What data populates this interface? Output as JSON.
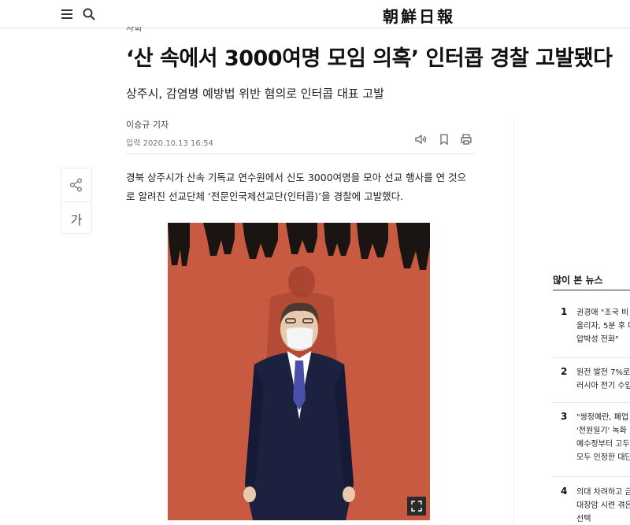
{
  "header": {
    "logo": "朝鮮日報",
    "menu_icon": "hamburger-menu-icon",
    "search_icon": "search-icon"
  },
  "article": {
    "section": "사회",
    "headline": "‘산 속에서 3000여명 모임 의혹’ 인터콥 경찰 고발됐다",
    "subheadline": "상주시, 감염병 예방법 위반 혐의로 인터콥 대표 고발",
    "byline": "이승규 기자",
    "dateline": "입력 2020.10.13 16:54",
    "tools": [
      "speaker-icon",
      "bookmark-icon",
      "print-icon"
    ],
    "body": [
      "경북 상주시가 산속 기독교 연수원에서 신도 3000여명을 모아 선교 행사를 연 것으",
      "로 알려진 선교단체 ‘전문인국제선교단(인터콥)’을 경찰에 고발했다."
    ]
  },
  "share_rail": {
    "share_icon": "share-icon",
    "font_label": "가"
  },
  "popular": {
    "title": "많이 본 뉴스",
    "items": [
      {
        "rank": "1",
        "lines": [
          "권경애 \"조국 비",
          "올리자, 5분 후 대",
          "압박성 전화\""
        ]
      },
      {
        "rank": "2",
        "lines": [
          "원전 발전 7%로",
          "러시아 전기 수입"
        ]
      },
      {
        "rank": "3",
        "lines": [
          "\"쌍정예란, 폐업",
          "'전원일기' 녹화",
          "예수정부터 고두",
          "모두 인정한 대단"
        ]
      },
      {
        "rank": "4",
        "lines": [
          "의대 차려하고 금",
          "대장암 시련 겪은",
          "선택"
        ]
      }
    ]
  },
  "colors": {
    "accent_background": "#c85a42",
    "suit": "#1d2140",
    "tie": "#4a4fa8"
  }
}
